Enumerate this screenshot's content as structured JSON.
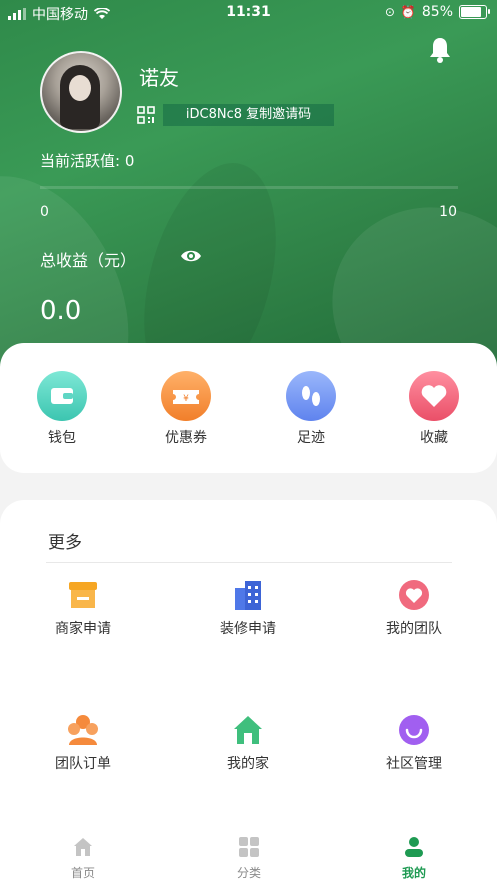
{
  "status_bar": {
    "carrier": "中国移动",
    "time": "11:31",
    "battery": "85%",
    "battery_level": 0.85
  },
  "profile": {
    "username": "诺友",
    "invite_text": "iDC8Nc8 复制邀请码",
    "activity_label": "当前活跃值: 0",
    "activity_value": 0,
    "activity_max": 10,
    "progress_min": "0",
    "progress_max": "10",
    "earnings_label": "总收益（元）",
    "earnings_value": "0.0"
  },
  "quick_actions": [
    {
      "label": "钱包",
      "icon": "wallet-icon",
      "color": "#5fd6c4"
    },
    {
      "label": "优惠券",
      "icon": "coupon-icon",
      "color": "#f79a45"
    },
    {
      "label": "足迹",
      "icon": "footprint-icon",
      "color": "#6f93f2"
    },
    {
      "label": "收藏",
      "icon": "heart-icon",
      "color": "#f0647a"
    }
  ],
  "more": {
    "title": "更多",
    "items": [
      {
        "label": "商家申请",
        "icon": "store-icon"
      },
      {
        "label": "装修申请",
        "icon": "building-icon"
      },
      {
        "label": "我的团队",
        "icon": "team-heart-icon"
      },
      {
        "label": "团队订单",
        "icon": "group-icon"
      },
      {
        "label": "我的家",
        "icon": "home-icon"
      },
      {
        "label": "社区管理",
        "icon": "smile-icon"
      }
    ]
  },
  "tabbar": {
    "tabs": [
      {
        "label": "首页",
        "icon": "home-tab-icon"
      },
      {
        "label": "分类",
        "icon": "grid-icon"
      },
      {
        "label": "我的",
        "icon": "person-icon",
        "active": true
      }
    ]
  },
  "colors": {
    "accent": "#1e9a52",
    "hero": "#2f8a4a"
  }
}
